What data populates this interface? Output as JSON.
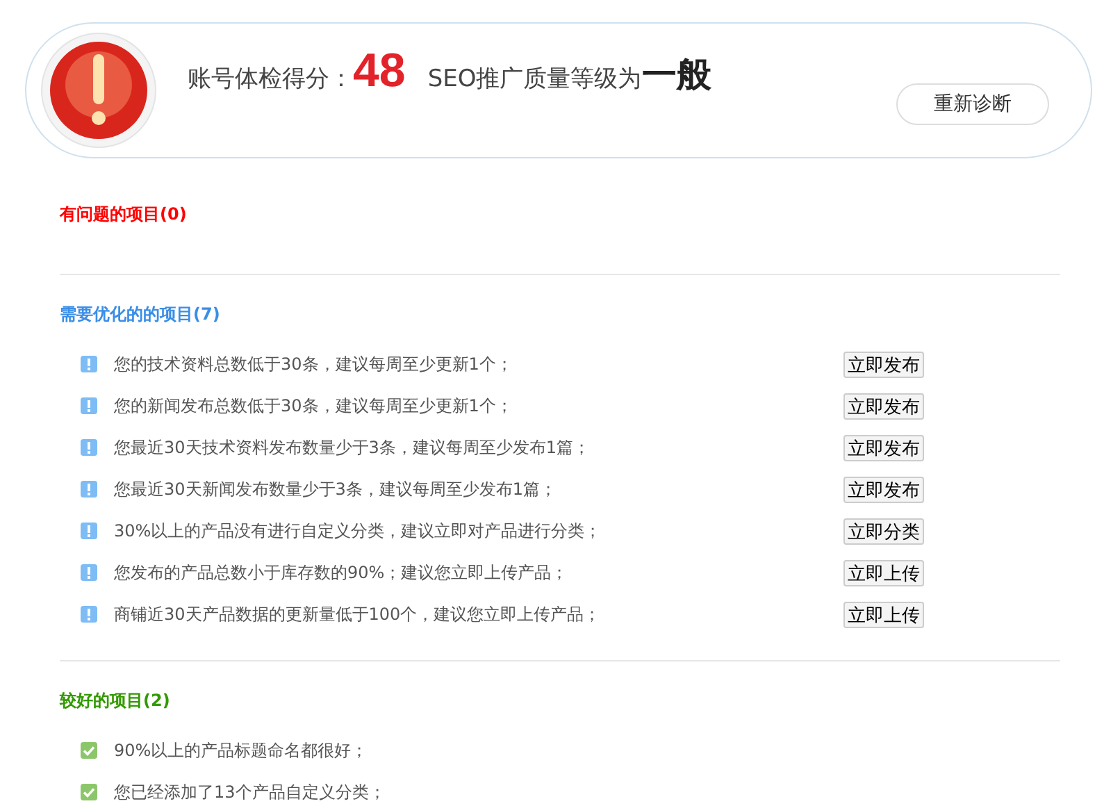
{
  "summary": {
    "score_label": "账号体检得分：",
    "score": "48",
    "grade_label": "SEO推广质量等级为",
    "grade": "一般",
    "button": "重新诊断"
  },
  "sections": [
    {
      "kind": "problem",
      "title": "有问题的项目(0)"
    },
    {
      "kind": "optimize",
      "title": "需要优化的的项目(7)",
      "items": [
        {
          "kind": "warning",
          "text": "您的技术资料总数低于30条，建议每周至少更新1个；",
          "action": "立即发布"
        },
        {
          "kind": "warning",
          "text": "您的新闻发布总数低于30条，建议每周至少更新1个；",
          "action": "立即发布"
        },
        {
          "kind": "warning",
          "text": "您最近30天技术资料发布数量少于3条，建议每周至少发布1篇；",
          "action": "立即发布"
        },
        {
          "kind": "warning",
          "text": "您最近30天新闻发布数量少于3条，建议每周至少发布1篇；",
          "action": "立即发布"
        },
        {
          "kind": "warning",
          "text": "30%以上的产品没有进行自定义分类，建议立即对产品进行分类；",
          "action": "立即分类"
        },
        {
          "kind": "warning",
          "text": "您发布的产品总数小于库存数的90%；建议您立即上传产品；",
          "action": "立即上传"
        },
        {
          "kind": "warning",
          "text": "商铺近30天产品数据的更新量低于100个，建议您立即上传产品；",
          "action": "立即上传"
        }
      ]
    },
    {
      "kind": "good",
      "title": "较好的项目(2)",
      "items": [
        {
          "kind": "ok",
          "text": "90%以上的产品标题命名都很好；"
        },
        {
          "kind": "ok",
          "text": "您已经添加了13个产品自定义分类；"
        }
      ]
    }
  ]
}
